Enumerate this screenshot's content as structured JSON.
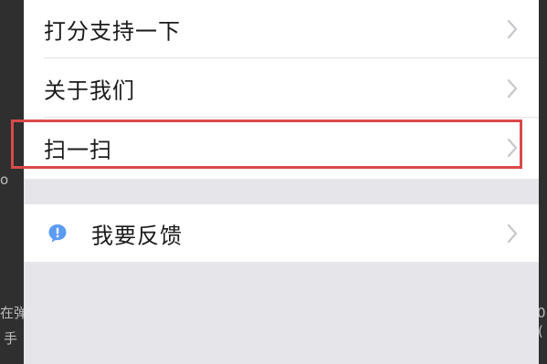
{
  "menu": {
    "items": [
      {
        "label": "打分支持一下"
      },
      {
        "label": "关于我们"
      },
      {
        "label": "扫一扫"
      }
    ]
  },
  "feedback": {
    "label": "我要反馈",
    "icon": "speech-bubble-exclamation-icon"
  },
  "background": {
    "fragments": [
      "o",
      "在弹",
      "手",
      "0",
      "("
    ]
  },
  "colors": {
    "highlight": "#d94a4a",
    "accent_icon": "#5b9bf5",
    "group_bg": "#e5e5ea"
  }
}
